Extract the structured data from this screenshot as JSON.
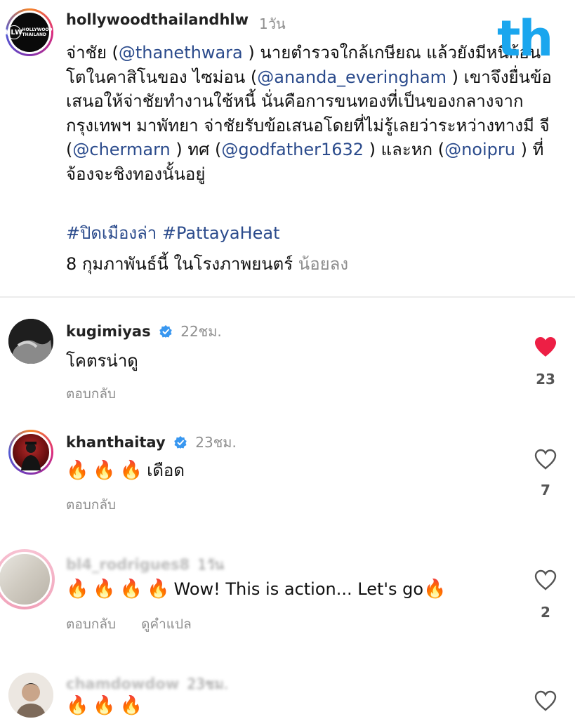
{
  "post": {
    "avatar_alt": "HLW HOLLYWOOD THAILAND",
    "avatar_mark": "HLW",
    "avatar_text": "HOLLYWOOD THAILAND",
    "username": "hollywoodthailandhlw",
    "time": "1วัน",
    "caption": {
      "p1": "จ่าชัย (",
      "m1": "@thanethwara",
      "p2": " ) นายตำรวจใกล้เกษียณ แล้วยังมีหนี้ก้อนโตในคาสิโนของ ไซม่อน (",
      "m2": "@ananda_everingham",
      "p3": " ) เขาจึงยื่นข้อเสนอให้จ่าชัยทำงานใช้หนี้ นั่นคือการขนทองที่เป็นของกลางจากกรุงเทพฯ มาพัทยา จ่าชัยรับข้อเสนอโดยที่ไม่รู้เลยว่าระหว่างทางมี จี (",
      "m3": "@chermarn",
      "p4": " ) ทศ (",
      "m4": "@godfather1632",
      "p5": " ) และหก (",
      "m5": "@noipru",
      "p6": " ) ที่จ้องจะชิงทองนั้นอยู่"
    },
    "hashtags": "#ปิดเมืองล่า #PattayaHeat",
    "release": "8 กุมภาพันธ์นี้ ในโรงภาพยนตร์",
    "see_less": "น้อยลง"
  },
  "brand_logo": "th",
  "comments": [
    {
      "username": "kugimiyas",
      "verified": true,
      "time": "22ชม.",
      "text": "โคตรน่าดู",
      "reply": "ตอบกลับ",
      "liked": true,
      "likes": "23"
    },
    {
      "username": "khanthaitay",
      "verified": true,
      "time": "23ชม.",
      "text": "เดือด",
      "fires": 3,
      "reply": "ตอบกลับ",
      "liked": false,
      "likes": "7"
    },
    {
      "username": "bl4_rodrigues8",
      "time": "1วัน",
      "text": "Wow! This is action... Let's go",
      "fires": 4,
      "reply": "ตอบกลับ",
      "translate": "ดูคำแปล",
      "liked": false,
      "likes": "2"
    },
    {
      "username": "chamdowdow",
      "time": "23ชม.",
      "fires": 3,
      "liked": false
    }
  ],
  "colors": {
    "link": "#2b4b8c",
    "muted": "#8e8e8e",
    "like_red": "#ed1f45",
    "verified_blue": "#3897f0",
    "brand_blue": "#1aa6ee"
  },
  "icons": {
    "fire": "🔥",
    "heart": "heart-icon",
    "verified": "verified-badge-icon"
  }
}
